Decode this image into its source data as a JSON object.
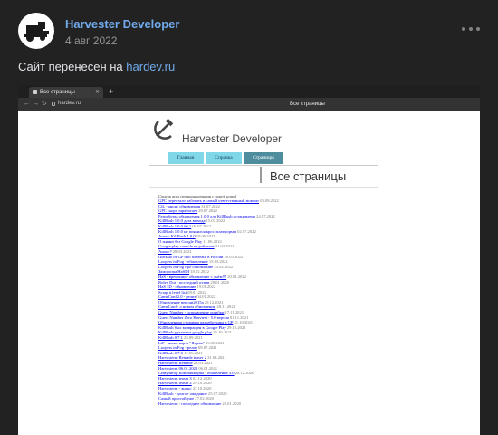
{
  "post": {
    "author": "Harvester Developer",
    "date": "4 авг 2022",
    "text_prefix": "Сайт перенесен на ",
    "link": "hardev.ru"
  },
  "browser": {
    "tab_title": "Все страницы",
    "url": "hardev.ru",
    "page_title": "Все страницы"
  },
  "site": {
    "logo_text": "Harvester Developer",
    "menu": [
      "Главная",
      "Справка",
      "Страницы"
    ],
    "heading": "Все страницы",
    "intro": "Список всех страниц начиная с самой новой",
    "pages": [
      {
        "title": "GPC перестало работать в самый ответственный момент",
        "date": "03.08.2022"
      },
      {
        "title": "CtL - анонс обновления",
        "date": "31.07.2022"
      },
      {
        "title": "GPC скоро заработает",
        "date": "29.07.2022"
      },
      {
        "title": "Разработка обновления 1.0.0 для KillRush остановлена",
        "date": "24.07.2022"
      },
      {
        "title": "KillRush 1.0.0 дата выхода",
        "date": "15.07.2022"
      },
      {
        "title": "KillRush 1.0.0 бб 1",
        "date": "09.07.2022"
      },
      {
        "title": "KillRush 1.0.0 не появился кроссплатформы",
        "date": "02.07.2022"
      },
      {
        "title": "Анонс KillRush 1.0.0",
        "date": "19.06.2022"
      },
      {
        "title": "О жизни без Google Play",
        "date": "11.06.2022"
      },
      {
        "title": "Google play console не работает",
        "date": "31.03.2022"
      },
      {
        "title": "Анонс?",
        "date": "28.03.2022"
      },
      {
        "title": "Письмо от GP про платежи в России",
        "date": "20.03.2022"
      },
      {
        "title": "Loopers in Fog - обновление",
        "date": "15.03.2022"
      },
      {
        "title": "Loopers in Fog про обновление",
        "date": "25.02.2022"
      },
      {
        "title": "Заморозка HaSDI",
        "date": "18.02.2022"
      },
      {
        "title": "HaS - временное обновление с днём!!!",
        "date": "20.01.2022"
      },
      {
        "title": "Rolex Dot - последний отзыв",
        "date": "20.01.2020"
      },
      {
        "title": "HaS 3D - обновление",
        "date": "19.01.2022"
      },
      {
        "title": "Scrap it level list",
        "date": "08.01.2022"
      },
      {
        "title": "CameCard 2.0 - релиз",
        "date": "04.01.2022"
      },
      {
        "title": "Обновление версии2015а",
        "date": "29.12.2021"
      },
      {
        "title": "CameCard - о новом обновлении",
        "date": "28.11.2021"
      },
      {
        "title": "Guess Number - исправление ошибки",
        "date": "17.11.2021"
      },
      {
        "title": "Guess Number Zero Harvtest - 5.0 версия",
        "date": "01.11.2021"
      },
      {
        "title": "Обновленная страница разработчика в GP",
        "date": "31.10.2021"
      },
      {
        "title": "KillRush был возвращен в Google Play",
        "date": "29.10.2021"
      },
      {
        "title": "KillRush удален из google play",
        "date": "25.10.2021"
      },
      {
        "title": "KillRush 0.7.1",
        "date": "25.09.2021"
      },
      {
        "title": "LiF - новая карта \"Ферма\"",
        "date": "26.08.2021"
      },
      {
        "title": "Loopers in Fog - релиз",
        "date": "09.07.2021"
      },
      {
        "title": "KillRush 0.7.0",
        "date": "12.06.2021"
      },
      {
        "title": "Harvesterm Remade teaser 2",
        "date": "31.03.2021"
      },
      {
        "title": "Harvesterm Remade",
        "date": "23.03.2021"
      },
      {
        "title": "Harvesterm 06.01.2021",
        "date": "06.01.2021"
      },
      {
        "title": "Симулятор Комбайнщика - обновление 3.0",
        "date": "28.12.2020"
      },
      {
        "title": "Harvesterm teaser 3",
        "date": "02.12.2020"
      },
      {
        "title": "Harvesterm teaser 2",
        "date": "29.10.2020"
      },
      {
        "title": "Harvesterm - анонс",
        "date": "27.10.2020"
      },
      {
        "title": "KillRush - долгое ожидание",
        "date": "25.07.2020"
      },
      {
        "title": "Самый простой уже",
        "date": "27.02.2020"
      },
      {
        "title": "Harvesterm - последнее обновление",
        "date": "20.01.2020"
      }
    ]
  },
  "colors": {
    "background": "#222222",
    "accent": "#71aaeb",
    "menu_button": "#7fd7e8",
    "menu_active": "#4e8d9e"
  }
}
